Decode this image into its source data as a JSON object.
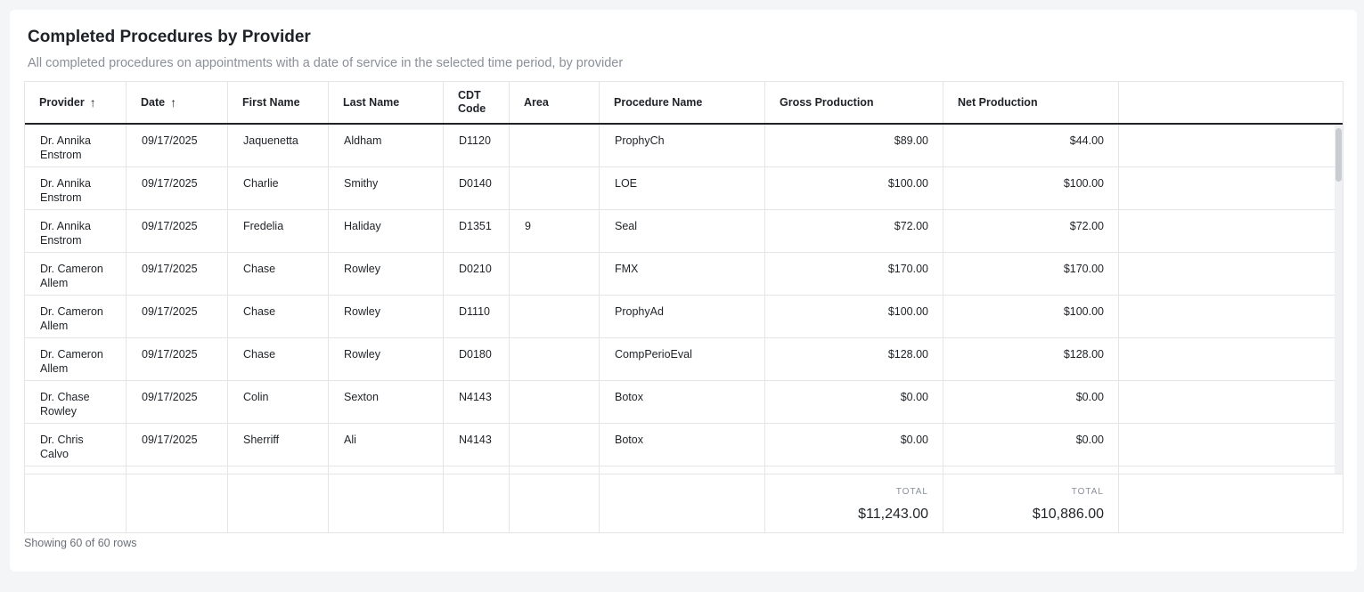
{
  "title": "Completed Procedures by Provider",
  "subtitle": "All completed procedures on appointments with a date of service in the selected time period, by provider",
  "columns": [
    {
      "label": "Provider",
      "sort": "asc"
    },
    {
      "label": "Date",
      "sort": "asc"
    },
    {
      "label": "First Name"
    },
    {
      "label": "Last Name"
    },
    {
      "label": "CDT Code"
    },
    {
      "label": "Area"
    },
    {
      "label": "Procedure Name"
    },
    {
      "label": "Gross Production"
    },
    {
      "label": "Net Production"
    }
  ],
  "rows": [
    {
      "provider": "Dr. Annika Enstrom",
      "date": "09/17/2025",
      "first": "Jaquenetta",
      "last": "Aldham",
      "cdt": "D1120",
      "area": "",
      "procedure": "ProphyCh",
      "gross": "$89.00",
      "net": "$44.00"
    },
    {
      "provider": "Dr. Annika Enstrom",
      "date": "09/17/2025",
      "first": "Charlie",
      "last": "Smithy",
      "cdt": "D0140",
      "area": "",
      "procedure": "LOE",
      "gross": "$100.00",
      "net": "$100.00"
    },
    {
      "provider": "Dr. Annika Enstrom",
      "date": "09/17/2025",
      "first": "Fredelia",
      "last": "Haliday",
      "cdt": "D1351",
      "area": "9",
      "procedure": "Seal",
      "gross": "$72.00",
      "net": "$72.00"
    },
    {
      "provider": "Dr. Cameron Allem",
      "date": "09/17/2025",
      "first": "Chase",
      "last": "Rowley",
      "cdt": "D0210",
      "area": "",
      "procedure": "FMX",
      "gross": "$170.00",
      "net": "$170.00"
    },
    {
      "provider": "Dr. Cameron Allem",
      "date": "09/17/2025",
      "first": "Chase",
      "last": "Rowley",
      "cdt": "D1110",
      "area": "",
      "procedure": "ProphyAd",
      "gross": "$100.00",
      "net": "$100.00"
    },
    {
      "provider": "Dr. Cameron Allem",
      "date": "09/17/2025",
      "first": "Chase",
      "last": "Rowley",
      "cdt": "D0180",
      "area": "",
      "procedure": "CompPerioEval",
      "gross": "$128.00",
      "net": "$128.00"
    },
    {
      "provider": "Dr. Chase Rowley",
      "date": "09/17/2025",
      "first": "Colin",
      "last": "Sexton",
      "cdt": "N4143",
      "area": "",
      "procedure": "Botox",
      "gross": "$0.00",
      "net": "$0.00"
    },
    {
      "provider": "Dr. Chris Calvo",
      "date": "09/17/2025",
      "first": "Sherriff",
      "last": "Ali",
      "cdt": "N4143",
      "area": "",
      "procedure": "Botox",
      "gross": "$0.00",
      "net": "$0.00"
    }
  ],
  "totals": {
    "gross_label": "TOTAL",
    "gross_value": "$11,243.00",
    "net_label": "TOTAL",
    "net_value": "$10,886.00"
  },
  "row_count_text": "Showing 60 of 60 rows",
  "icons": {
    "sort_asc": "arrow-up-icon"
  }
}
